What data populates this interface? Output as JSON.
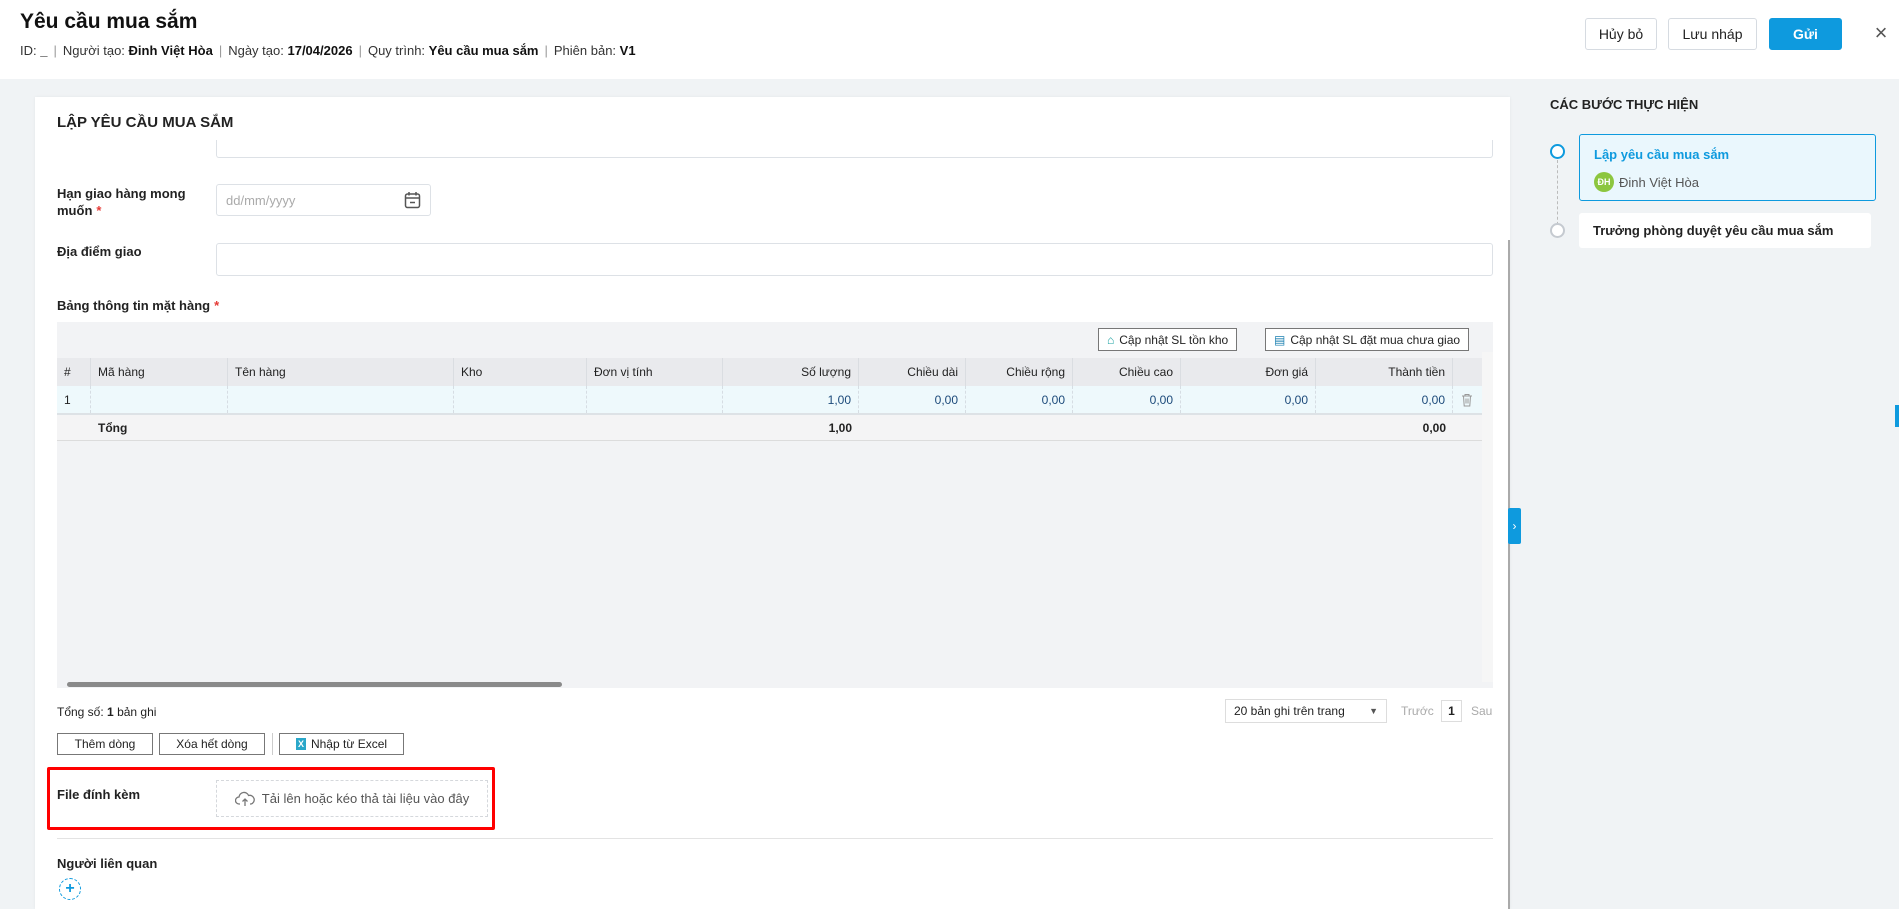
{
  "header": {
    "title": "Yêu cầu mua sắm",
    "meta": [
      {
        "label": "ID:",
        "value": "_"
      },
      {
        "label": "Người tạo:",
        "value": "Đinh Việt Hòa"
      },
      {
        "label": "Ngày tạo:",
        "value": "17/04/2026"
      },
      {
        "label": "Quy trình:",
        "value": "Yêu cầu mua sắm"
      },
      {
        "label": "Phiên bản:",
        "value": "V1"
      }
    ],
    "separator": "|",
    "cancel": "Hủy bỏ",
    "draft": "Lưu nháp",
    "send": "Gửi",
    "close": "×"
  },
  "form": {
    "title": "LẬP YÊU CẦU MUA SẮM",
    "delivery_deadline_label": "Hạn giao hàng mong muốn",
    "required": "*",
    "date_placeholder": "dd/mm/yyyy",
    "delivery_place_label": "Địa điểm giao",
    "items_label": "Bảng thông tin mặt hàng",
    "table": {
      "update_stock": "Cập nhật SL tồn kho",
      "update_ordered": "Cập nhật SL đặt mua chưa giao",
      "columns": [
        "#",
        "Mã hàng",
        "Tên hàng",
        "Kho",
        "Đơn vị tính",
        "Số lượng",
        "Chiều dài",
        "Chiều rộng",
        "Chiều cao",
        "Đơn giá",
        "Thành tiền"
      ],
      "rows": [
        [
          "1",
          "",
          "",
          "",
          "",
          "1,00",
          "0,00",
          "0,00",
          "0,00",
          "0,00",
          "0,00"
        ]
      ],
      "total_label": "Tổng",
      "total_qty": "1,00",
      "total_amount": "0,00"
    },
    "total_records_prefix": "Tổng số:",
    "total_records": "1",
    "total_records_suffix": "bản ghi",
    "page_size": "20 bản ghi trên trang",
    "prev": "Trước",
    "page": "1",
    "next": "Sau",
    "add_row": "Thêm dòng",
    "delete_all": "Xóa hết dòng",
    "import_excel": "Nhập từ Excel",
    "attachment_label": "File đính kèm",
    "upload_text": "Tải lên hoặc kéo thả tài liệu vào đây",
    "related_label": "Người liên quan"
  },
  "steps": {
    "title": "CÁC BƯỚC THỰC HIỆN",
    "items": [
      {
        "name": "Lập yêu cầu mua sắm",
        "assignee": "Đinh Việt Hòa",
        "initials": "ĐH"
      },
      {
        "name": "Trưởng phòng duyệt yêu cầu mua sắm"
      }
    ]
  },
  "colors": {
    "accent": "#0e9ade",
    "avatar": "#8cc63f",
    "highlight": "#f00"
  }
}
